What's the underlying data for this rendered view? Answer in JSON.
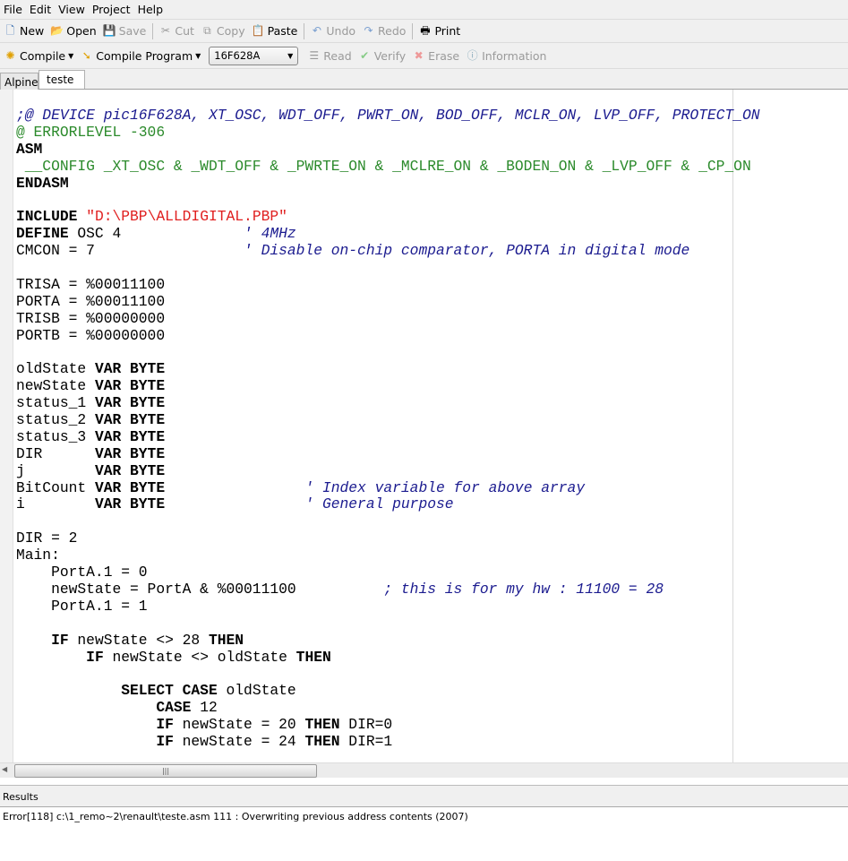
{
  "menu": [
    "File",
    "Edit",
    "View",
    "Project",
    "Help"
  ],
  "toolbar1": {
    "new": "New",
    "open": "Open",
    "save": "Save",
    "cut": "Cut",
    "copy": "Copy",
    "paste": "Paste",
    "undo": "Undo",
    "redo": "Redo",
    "print": "Print"
  },
  "toolbar2": {
    "compile": "Compile",
    "compile_program": "Compile Program",
    "device": "16F628A",
    "read": "Read",
    "verify": "Verify",
    "erase": "Erase",
    "information": "Information"
  },
  "tabs": [
    "Alpine",
    "teste"
  ],
  "code": [
    [
      [
        ";@ DEVICE pic16F628A, XT_OSC, WDT_OFF, PWRT_ON, BOD_OFF, MCLR_ON, LVP_OFF, PROTECT_ON",
        "cm"
      ]
    ],
    [
      [
        "@ ERRORLEVEL -306",
        "asm"
      ]
    ],
    [
      [
        "ASM",
        "kw"
      ]
    ],
    [
      [
        " __CONFIG _XT_OSC & _WDT_OFF & _PWRTE_ON & _MCLRE_ON & _BODEN_ON & _LVP_OFF & _CP_ON",
        "asm"
      ]
    ],
    [
      [
        "ENDASM",
        "kw"
      ]
    ],
    [],
    [
      [
        "INCLUDE",
        "kw"
      ],
      [
        " ",
        ""
      ],
      [
        "\"D:\\PBP\\ALLDIGITAL.PBP\"",
        "str"
      ]
    ],
    [
      [
        "DEFINE",
        "kw"
      ],
      [
        " OSC 4              ",
        ""
      ],
      [
        "' 4MHz",
        "cm"
      ]
    ],
    [
      [
        "CMCON = 7                 ",
        ""
      ],
      [
        "' Disable on-chip comparator, PORTA in digital mode",
        "cm"
      ]
    ],
    [],
    [
      [
        "TRISA = %00011100",
        ""
      ]
    ],
    [
      [
        "PORTA = %00011100",
        ""
      ]
    ],
    [
      [
        "TRISB = %00000000",
        ""
      ]
    ],
    [
      [
        "PORTB = %00000000",
        ""
      ]
    ],
    [],
    [
      [
        "oldState ",
        ""
      ],
      [
        "VAR BYTE",
        "kw"
      ]
    ],
    [
      [
        "newState ",
        ""
      ],
      [
        "VAR BYTE",
        "kw"
      ]
    ],
    [
      [
        "status_1 ",
        ""
      ],
      [
        "VAR BYTE",
        "kw"
      ]
    ],
    [
      [
        "status_2 ",
        ""
      ],
      [
        "VAR BYTE",
        "kw"
      ]
    ],
    [
      [
        "status_3 ",
        ""
      ],
      [
        "VAR BYTE",
        "kw"
      ]
    ],
    [
      [
        "DIR      ",
        ""
      ],
      [
        "VAR BYTE",
        "kw"
      ]
    ],
    [
      [
        "j        ",
        ""
      ],
      [
        "VAR BYTE",
        "kw"
      ]
    ],
    [
      [
        "BitCount ",
        ""
      ],
      [
        "VAR BYTE",
        "kw"
      ],
      [
        "                ",
        ""
      ],
      [
        "' Index variable for above array",
        "cm"
      ]
    ],
    [
      [
        "i        ",
        ""
      ],
      [
        "VAR BYTE",
        "kw"
      ],
      [
        "                ",
        ""
      ],
      [
        "' General purpose",
        "cm"
      ]
    ],
    [],
    [
      [
        "DIR = 2",
        ""
      ]
    ],
    [
      [
        "Main:",
        ""
      ]
    ],
    [
      [
        "    PortA.1 = 0",
        ""
      ]
    ],
    [
      [
        "    newState = PortA & %00011100          ",
        ""
      ],
      [
        "; this is for my hw : 11100 = 28",
        "cm"
      ]
    ],
    [
      [
        "    PortA.1 = 1",
        ""
      ]
    ],
    [],
    [
      [
        "    ",
        ""
      ],
      [
        "IF",
        "kw"
      ],
      [
        " newState <> 28 ",
        ""
      ],
      [
        "THEN",
        "kw"
      ]
    ],
    [
      [
        "        ",
        ""
      ],
      [
        "IF",
        "kw"
      ],
      [
        " newState <> oldState ",
        ""
      ],
      [
        "THEN",
        "kw"
      ]
    ],
    [],
    [
      [
        "            ",
        ""
      ],
      [
        "SELECT CASE",
        "kw"
      ],
      [
        " oldState",
        ""
      ]
    ],
    [
      [
        "                ",
        ""
      ],
      [
        "CASE",
        "kw"
      ],
      [
        " 12",
        ""
      ]
    ],
    [
      [
        "                ",
        ""
      ],
      [
        "IF",
        "kw"
      ],
      [
        " newState = 20 ",
        ""
      ],
      [
        "THEN",
        "kw"
      ],
      [
        " DIR=0",
        ""
      ]
    ],
    [
      [
        "                ",
        ""
      ],
      [
        "IF",
        "kw"
      ],
      [
        " newState = 24 ",
        ""
      ],
      [
        "THEN",
        "kw"
      ],
      [
        " DIR=1",
        ""
      ]
    ]
  ],
  "results": {
    "title": "Results",
    "message": "Error[118] c:\\1_remo~2\\renault\\teste.asm 111 : Overwriting previous address contents (2007)"
  },
  "colors": {
    "comment": "#1b1b8f",
    "asm": "#2b8a2b",
    "string": "#e02020"
  }
}
